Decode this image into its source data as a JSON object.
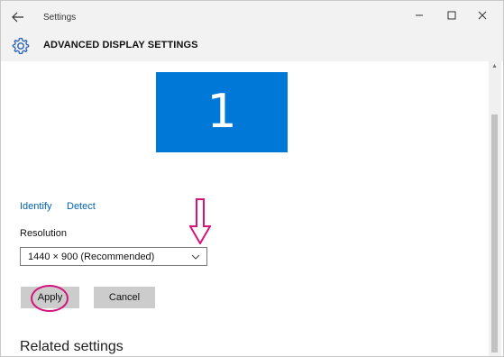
{
  "window": {
    "title": "Settings",
    "back_icon": "back-arrow-icon",
    "controls": {
      "minimize": "–",
      "maximize": "☐",
      "close": "✕"
    }
  },
  "page": {
    "title": "ADVANCED DISPLAY SETTINGS",
    "icon": "gear-icon"
  },
  "display": {
    "monitor_number": "1",
    "identify_label": "Identify",
    "detect_label": "Detect"
  },
  "resolution": {
    "label": "Resolution",
    "value": "1440 × 900 (Recommended)"
  },
  "actions": {
    "apply_label": "Apply",
    "cancel_label": "Cancel"
  },
  "related": {
    "heading": "Related settings"
  },
  "annotation": {
    "color": "#d4147b"
  }
}
